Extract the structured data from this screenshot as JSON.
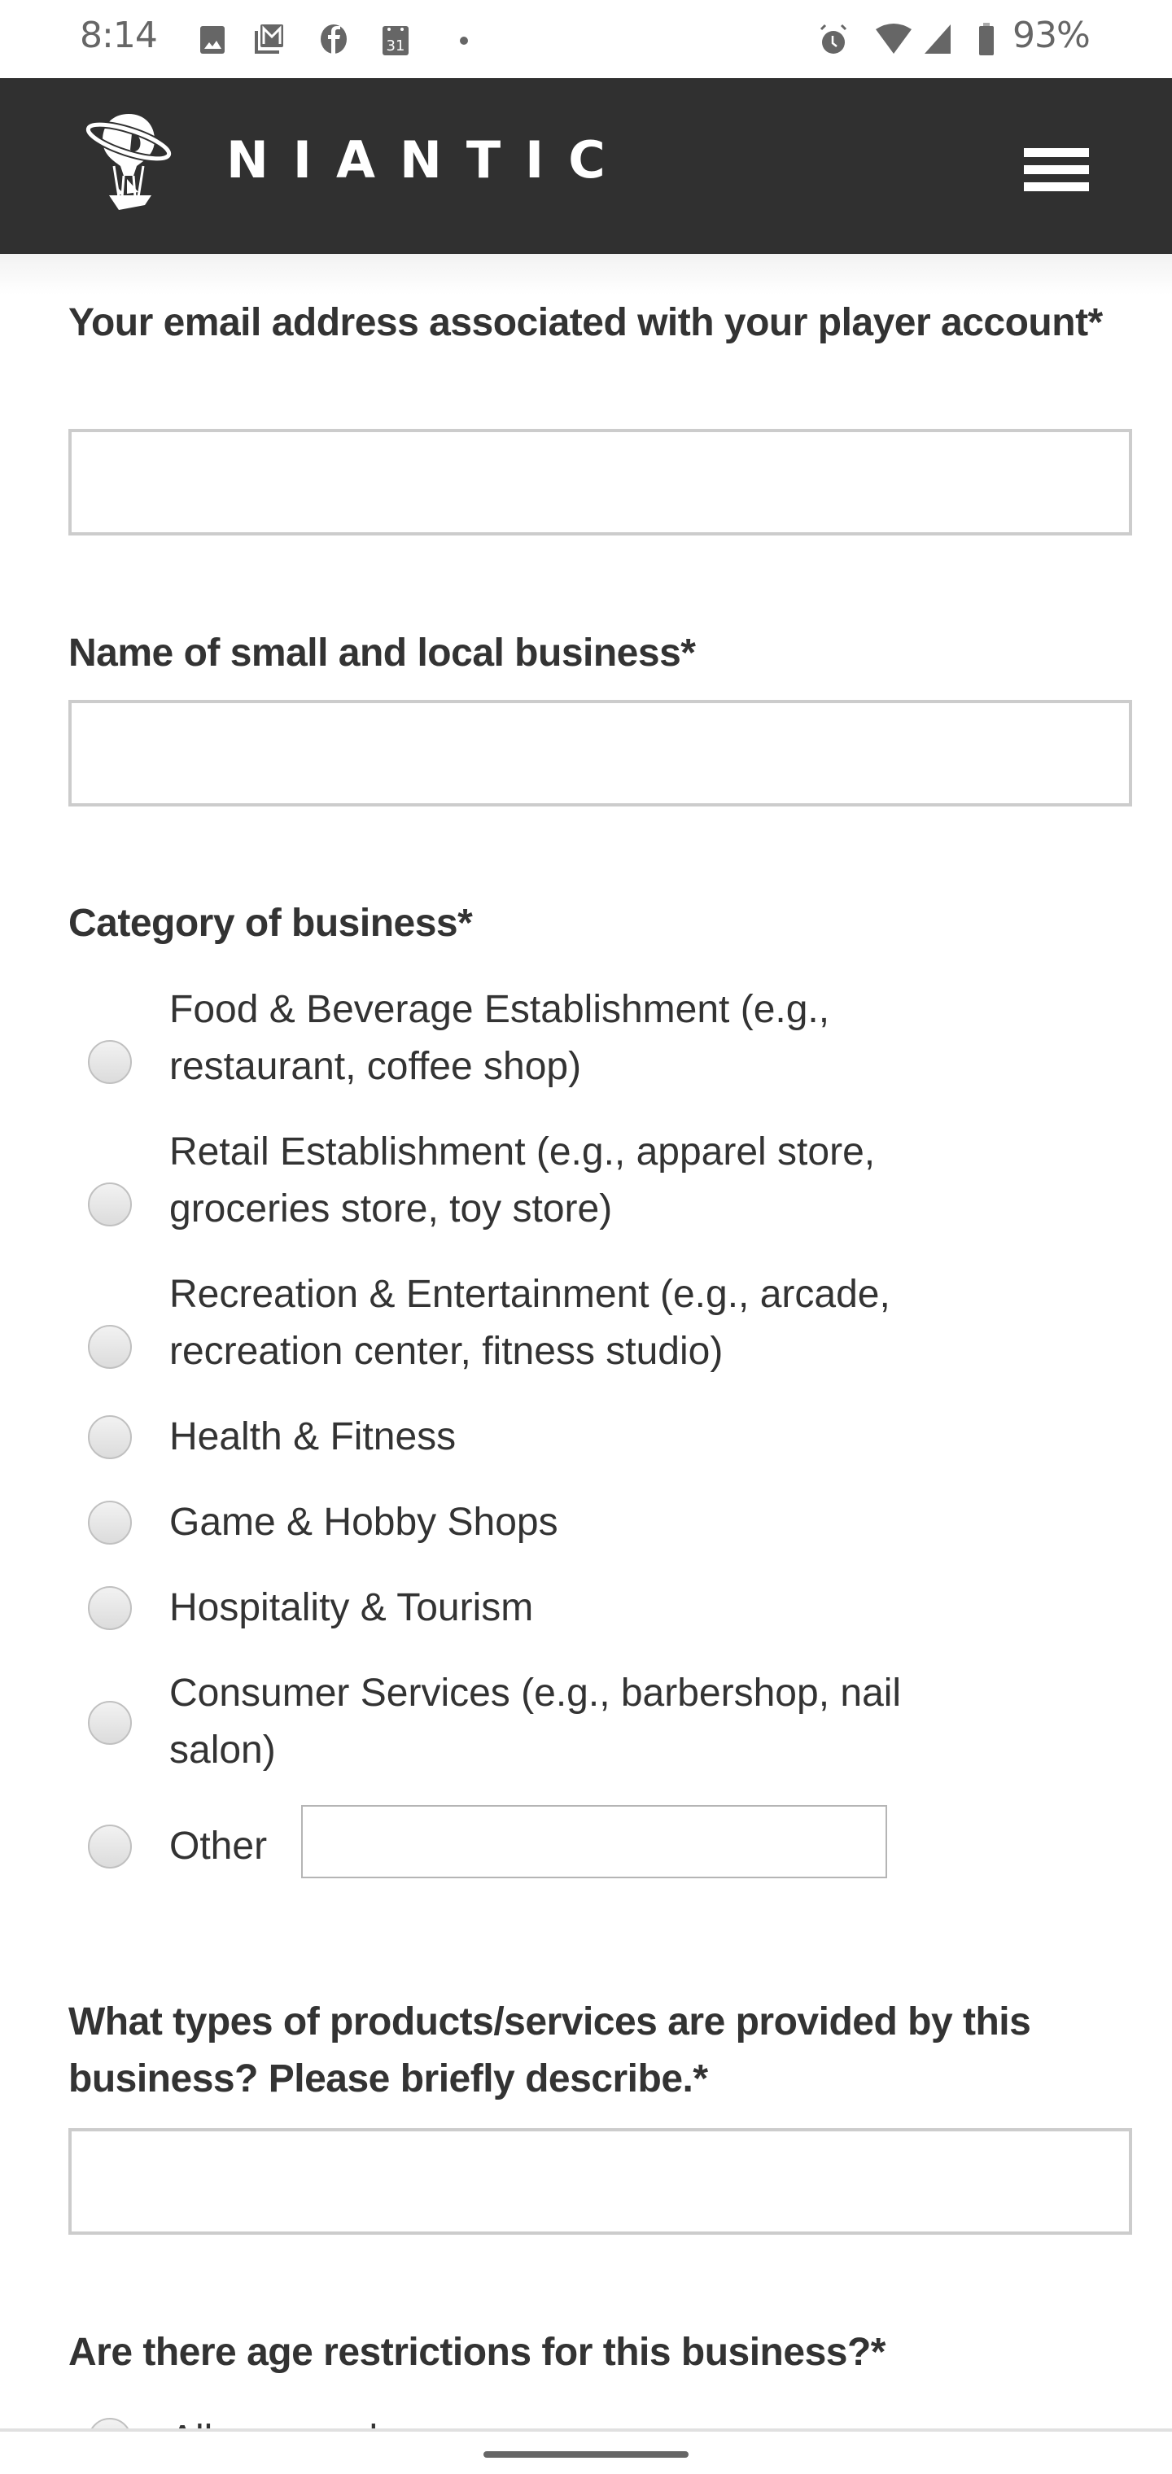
{
  "status_bar": {
    "time": "8:14",
    "notification_icons": [
      "photos-icon",
      "gmail-icon",
      "facebook-icon",
      "calendar-icon",
      "more-dot-icon"
    ],
    "calendar_day": "31",
    "system_icons": [
      "alarm-icon",
      "wifi-icon",
      "signal-icon",
      "battery-icon"
    ],
    "battery_percent": "93%",
    "icon_color": "#666666"
  },
  "header": {
    "brand": "NIANTIC",
    "logo": "airship-logo-icon",
    "menu_icon": "hamburger-menu-icon",
    "background_color": "#303030"
  },
  "form": {
    "email": {
      "label": "Your email address associated with your player account*",
      "value": "",
      "placeholder": ""
    },
    "business_name": {
      "label": "Name of small and local business*",
      "value": "",
      "placeholder": ""
    },
    "category": {
      "label": "Category of business*",
      "options": [
        {
          "line1": "Food & Beverage Establishment (e.g.,",
          "line2": "restaurant, coffee shop)",
          "selected": false
        },
        {
          "line1": "Retail Establishment (e.g., apparel store,",
          "line2": "groceries store, toy store)",
          "selected": false
        },
        {
          "line1": "Recreation & Entertainment (e.g., arcade,",
          "line2": "recreation center, fitness studio)",
          "selected": false
        },
        {
          "line1": "Health & Fitness",
          "line2": "",
          "selected": false
        },
        {
          "line1": "Game & Hobby Shops",
          "line2": "",
          "selected": false
        },
        {
          "line1": "Hospitality & Tourism",
          "line2": "",
          "selected": false
        },
        {
          "line1": "Consumer Services (e.g., barbershop, nail",
          "line2": "salon)",
          "selected": false
        },
        {
          "line1": "Other",
          "line2": "",
          "selected": false
        }
      ],
      "other_value": ""
    },
    "products": {
      "label_line1": "What types of products/services are provided by this",
      "label_line2": "business? Please briefly describe.*",
      "value": "",
      "placeholder": ""
    },
    "age_restrictions": {
      "label": "Are there age restrictions for this business?*",
      "first_option_partial": "All ages welcome"
    }
  }
}
